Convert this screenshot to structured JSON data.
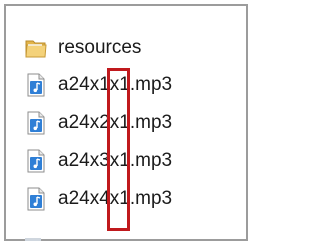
{
  "explorer": {
    "items": [
      {
        "name": "resources",
        "icon": "folder-icon"
      },
      {
        "name": "a24x1x1.mp3",
        "icon": "audio-file-icon"
      },
      {
        "name": "a24x2x1.mp3",
        "icon": "audio-file-icon"
      },
      {
        "name": "a24x3x1.mp3",
        "icon": "audio-file-icon"
      },
      {
        "name": "a24x4x1.mp3",
        "icon": "audio-file-icon"
      }
    ]
  },
  "annotation": {
    "color": "#c0191d"
  }
}
